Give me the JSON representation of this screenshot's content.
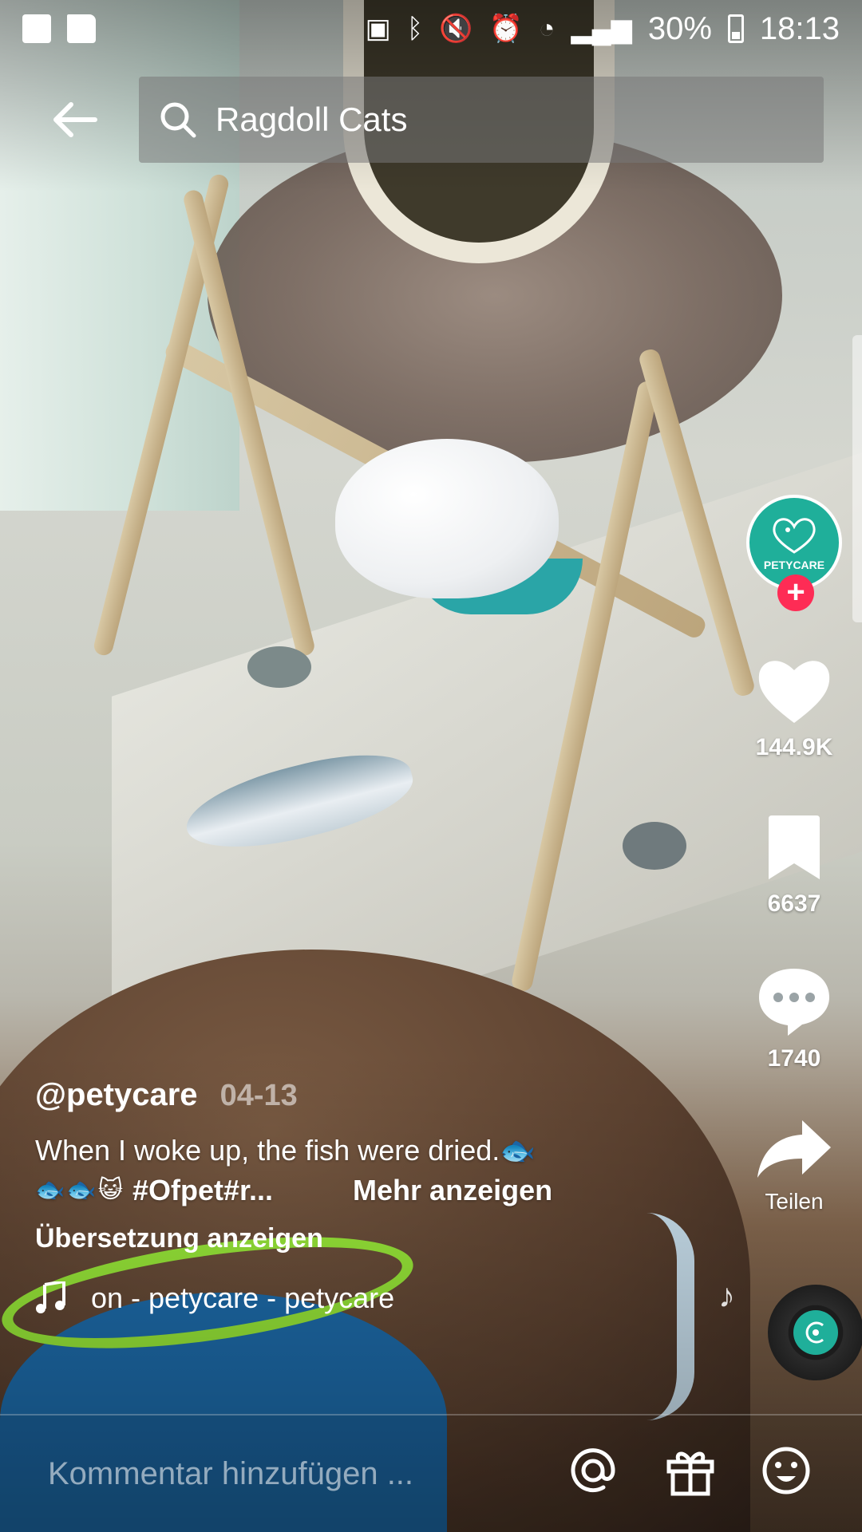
{
  "status_bar": {
    "battery": "30%",
    "time": "18:13",
    "left_icons": [
      "gallery-icon",
      "folder-icon"
    ],
    "right_icons": [
      "battery-saver-icon",
      "bluetooth-icon",
      "mute-icon",
      "alarm-icon",
      "wifi-icon",
      "signal-icon"
    ]
  },
  "search": {
    "query": "Ragdoll Cats"
  },
  "video": {
    "author": "@petycare",
    "date": "04-13",
    "description_line1": "When I woke up, the fish were dried.🐟",
    "description_emojis": "🐟🐟😺",
    "description_hashtags": "#Ofpet#r...",
    "more_label": "Mehr anzeigen",
    "translate_label": "Übersetzung anzeigen",
    "sound": "on - petycare - petycare"
  },
  "actions": {
    "avatar_label": "PETYCARE",
    "likes": "144.9K",
    "bookmarks": "6637",
    "comments": "1740",
    "share_label": "Teilen"
  },
  "comment_bar": {
    "placeholder": "Kommentar hinzufügen ..."
  },
  "colors": {
    "follow_red": "#fe2c55",
    "brand_teal": "#1faf9a"
  }
}
